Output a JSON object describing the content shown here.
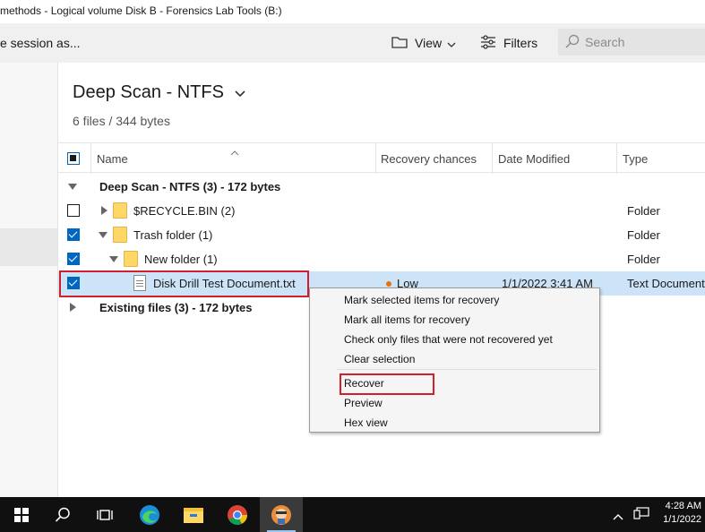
{
  "window": {
    "title": "methods - Logical volume Disk B - Forensics Lab Tools (B:)"
  },
  "toolbar": {
    "save_session_label": "e session as...",
    "view_label": "View",
    "filters_label": "Filters",
    "search_placeholder": "Search",
    "icons": {
      "view": "folder-icon",
      "filters": "sliders-icon",
      "search": "search-icon"
    }
  },
  "scan": {
    "title": "Deep Scan - NTFS",
    "subtitle": "6 files / 344 bytes"
  },
  "table": {
    "columns": [
      "Name",
      "Recovery chances",
      "Date Modified",
      "Type"
    ],
    "rows": [
      {
        "label": "Deep Scan - NTFS (3) - 172 bytes",
        "kind": "group",
        "expanded": true
      },
      {
        "label": "$RECYCLE.BIN (2)",
        "kind": "folder",
        "checked": false,
        "type": "Folder"
      },
      {
        "label": "Trash folder (1)",
        "kind": "folder",
        "checked": true,
        "type": "Folder"
      },
      {
        "label": "New folder (1)",
        "kind": "folder",
        "checked": true,
        "type": "Folder"
      },
      {
        "label": "Disk Drill Test Document.txt",
        "kind": "file",
        "checked": true,
        "recovery": "Low",
        "date": "1/1/2022 3:41 AM",
        "type": "Text Document"
      },
      {
        "label": "Existing files (3) - 172 bytes",
        "kind": "group",
        "expanded": false
      }
    ]
  },
  "context_menu": {
    "items": [
      "Mark selected items for recovery",
      "Mark all items for recovery",
      "Check only files that were not recovered yet",
      "Clear selection",
      "Recover",
      "Preview",
      "Hex view"
    ]
  },
  "taskbar": {
    "icons": [
      "windows-start-icon",
      "search-icon",
      "task-view-icon",
      "edge-icon",
      "file-explorer-icon",
      "chrome-icon",
      "disk-drill-icon"
    ],
    "time": "4:28 AM",
    "date": "1/1/2022"
  },
  "colors": {
    "accent": "#0067c0",
    "highlight_box": "#d0202e",
    "recovery_low": "#e8700c",
    "selected_row": "#cde3f7"
  }
}
